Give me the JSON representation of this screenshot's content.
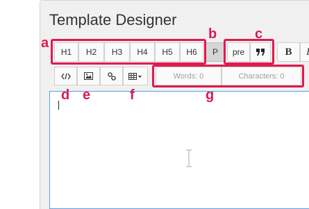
{
  "page": {
    "title": "Template Designer"
  },
  "toolbar_row1": {
    "headings": [
      "H1",
      "H2",
      "H3",
      "H4",
      "H5",
      "H6"
    ],
    "paragraph": "P",
    "pre": "pre",
    "quote_icon": "quote-icon",
    "bold": "B",
    "italic": "I"
  },
  "toolbar_row2": {
    "code_icon": "code-icon",
    "image_icon": "image-icon",
    "link_icon": "link-icon",
    "table_icon": "table-icon",
    "words": "Words: 0",
    "characters": "Characters: 0"
  },
  "annotations": {
    "a": "a",
    "b": "b",
    "c": "c",
    "d": "d",
    "e": "e",
    "f": "f",
    "g": "g",
    "color": "#e0194f"
  }
}
